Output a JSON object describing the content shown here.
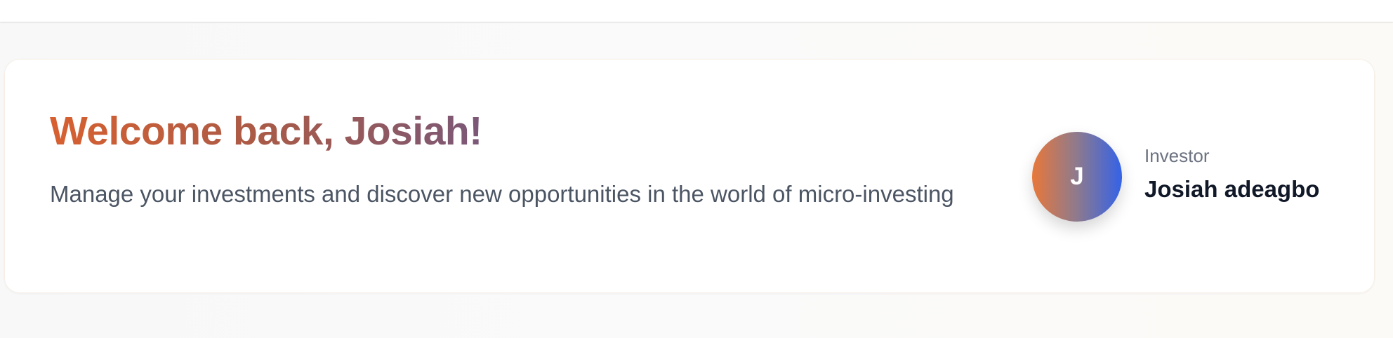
{
  "welcome": {
    "title": "Welcome back, Josiah!",
    "subtitle": "Manage your investments and discover new opportunities in the world of micro-investing"
  },
  "profile": {
    "avatar_initial": "J",
    "role": "Investor",
    "name": "Josiah adeagbo"
  },
  "colors": {
    "title_gradient": [
      "#d86030",
      "#a85a48",
      "#7a5878"
    ],
    "avatar_gradient": [
      "#e8783a",
      "#8d7a8e",
      "#3462e8"
    ],
    "subtitle_text": "#4b5563",
    "name_text": "#111827",
    "role_text": "#6b7280"
  }
}
